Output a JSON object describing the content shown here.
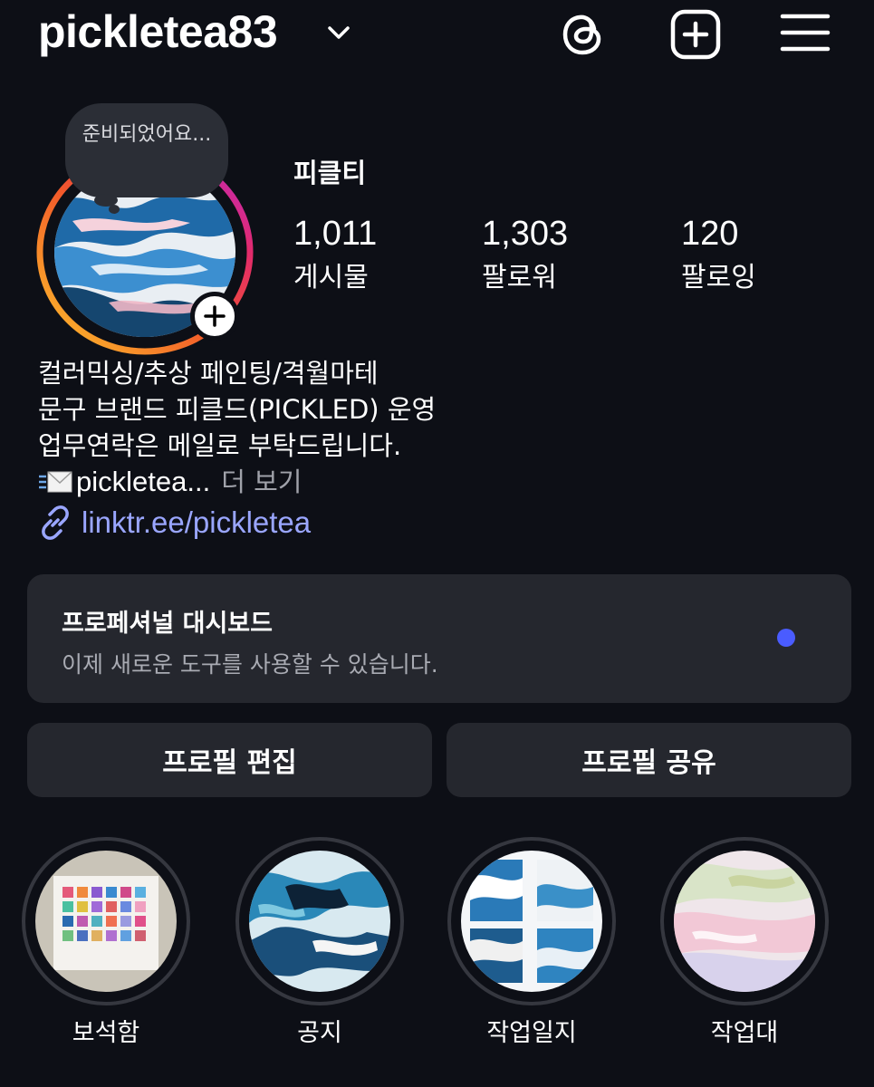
{
  "header": {
    "username": "pickletea83",
    "icons": [
      "chevron-down-icon",
      "threads-icon",
      "plus-square-icon",
      "hamburger-menu-icon"
    ]
  },
  "note": {
    "text": "준비되었어요..."
  },
  "profile": {
    "display_name": "피클티",
    "stats": [
      {
        "count": "1,011",
        "label": "게시물"
      },
      {
        "count": "1,303",
        "label": "팔로워"
      },
      {
        "count": "120",
        "label": "팔로잉"
      }
    ],
    "bio_lines": [
      "컬러믹싱/추상 페인팅/격월마테",
      "문구 브랜드 피클드(PICKLED) 운영",
      "업무연락은 메일로 부탁드립니다."
    ],
    "bio_email": "pickletea...",
    "bio_more": "더 보기",
    "link": "linktr.ee/pickletea"
  },
  "dashboard": {
    "title": "프로페셔널 대시보드",
    "subtitle": "이제 새로운 도구를 사용할 수 있습니다.",
    "dot_color": "#4a5cff"
  },
  "buttons": {
    "edit": "프로필 편집",
    "share": "프로필 공유"
  },
  "highlights": [
    {
      "label": "보석함"
    },
    {
      "label": "공지"
    },
    {
      "label": "작업일지"
    },
    {
      "label": "작업대"
    }
  ],
  "colors": {
    "background": "#0d0f16",
    "card": "#25272e",
    "link": "#9aa6ff"
  }
}
